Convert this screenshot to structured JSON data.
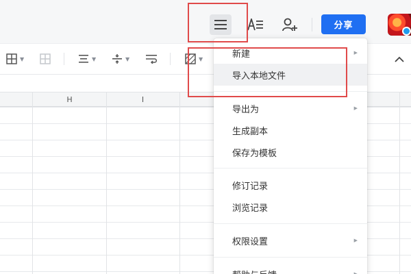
{
  "header": {
    "share_label": "分享"
  },
  "icons": {
    "menu": "hamburger-menu-icon",
    "text_format": "text-format-icon",
    "add_collaborator": "add-user-icon",
    "avatar_badge": "droplet-badge-icon"
  },
  "toolbar": {
    "items": [
      "borders-icon",
      "merge-cells-icon",
      "align-horizontal-icon",
      "align-vertical-icon",
      "wrap-text-icon",
      "conditional-format-icon"
    ],
    "collapse": "chevron-up-icon"
  },
  "sheet": {
    "columns": [
      "H",
      "I"
    ]
  },
  "menu": {
    "items": [
      {
        "label": "新建",
        "has_submenu": true
      },
      {
        "label": "导入本地文件",
        "has_submenu": false,
        "hovered": true
      },
      {
        "label": "导出为",
        "has_submenu": true
      },
      {
        "label": "生成副本",
        "has_submenu": false
      },
      {
        "label": "保存为模板",
        "has_submenu": false
      },
      {
        "label": "修订记录",
        "has_submenu": false
      },
      {
        "label": "浏览记录",
        "has_submenu": false
      },
      {
        "label": "权限设置",
        "has_submenu": true
      },
      {
        "label": "帮助与反馈",
        "has_submenu": true
      }
    ]
  },
  "colors": {
    "accent": "#1f6ff2",
    "annotation": "#e04a4a"
  }
}
